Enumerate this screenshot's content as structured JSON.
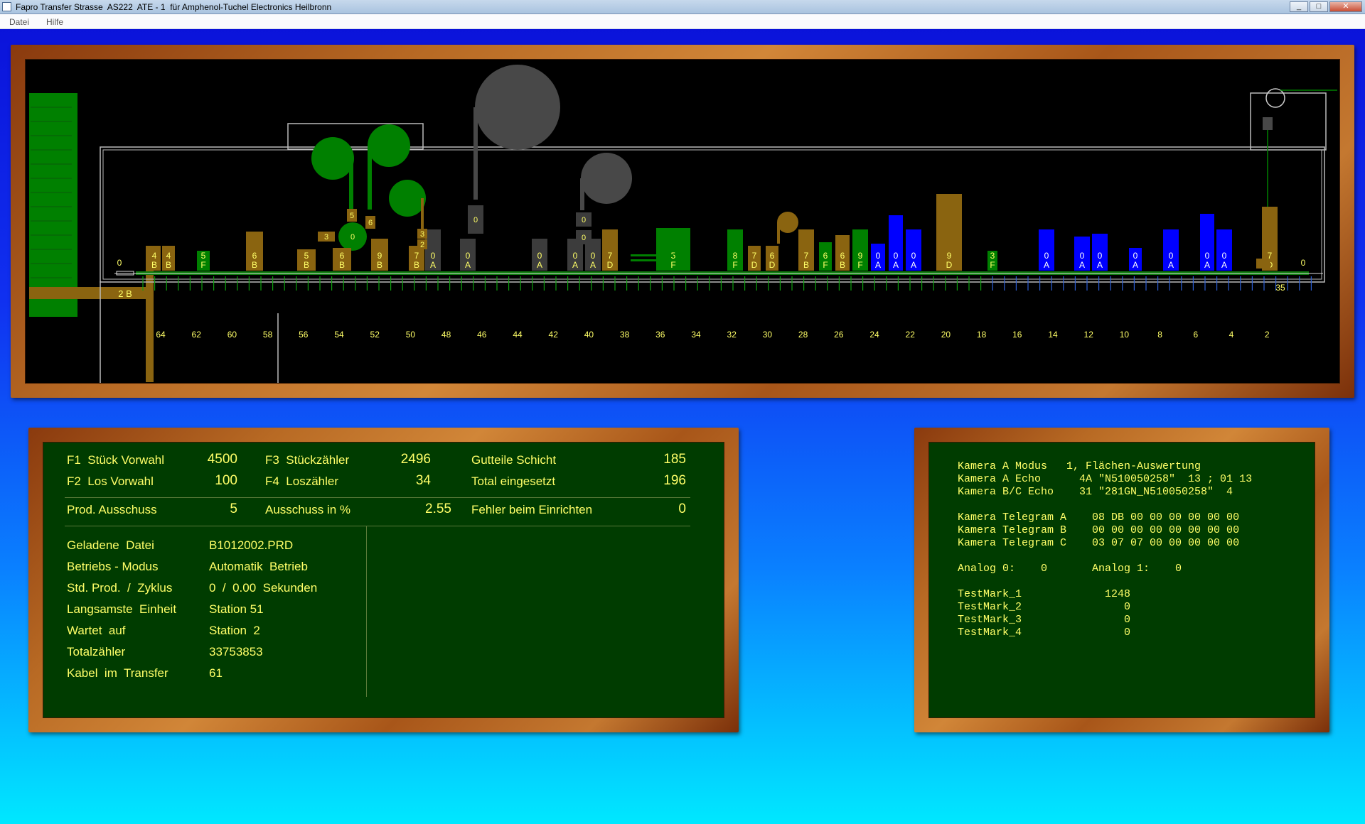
{
  "window": {
    "title": "Fapro Transfer Strasse  AS222  ATE - 1  für Amphenol-Tuchel Electronics Heilbronn",
    "minimize_symbol": "_",
    "maximize_symbol": "□",
    "close_symbol": "✕"
  },
  "menu": [
    "Datei",
    "Hilfe"
  ],
  "colors": {
    "part_green": "#008000",
    "part_brown": "#8a6410",
    "part_grey": "#3c3c3c",
    "part_blue": "#0000ff",
    "label_yellow": "#ffff68",
    "frame_wood": "#b86a24",
    "panel_green": "#003c00"
  },
  "schematic": {
    "feed_label": "2  B",
    "left_zero": "0",
    "right_zero": "0",
    "station_marker": "35",
    "station_numbers": [
      "64",
      "62",
      "60",
      "58",
      "56",
      "54",
      "52",
      "50",
      "48",
      "46",
      "44",
      "42",
      "40",
      "38",
      "36",
      "34",
      "32",
      "30",
      "28",
      "26",
      "24",
      "22",
      "20",
      "18",
      "16",
      "14",
      "12",
      "10",
      "8",
      "6",
      "4",
      "2"
    ],
    "parts": [
      {
        "num": "4",
        "letter": "B",
        "color": "brown"
      },
      {
        "num": "4",
        "letter": "B",
        "color": "brown"
      },
      {
        "num": "5",
        "letter": "F",
        "color": "green"
      },
      {
        "num": "6",
        "letter": "B",
        "color": "brown"
      },
      {
        "num": "5",
        "letter": "B",
        "color": "brown"
      },
      {
        "num": "6",
        "letter": "B",
        "color": "brown"
      },
      {
        "num": "9",
        "letter": "B",
        "color": "brown"
      },
      {
        "num": "7",
        "letter": "B",
        "color": "brown"
      },
      {
        "num": "0",
        "letter": "A",
        "color": "grey"
      },
      {
        "num": "0",
        "letter": "A",
        "color": "grey"
      },
      {
        "num": "0",
        "letter": "A",
        "color": "grey"
      },
      {
        "num": "0",
        "letter": "A",
        "color": "grey"
      },
      {
        "num": "0",
        "letter": "A",
        "color": "grey"
      },
      {
        "num": "7",
        "letter": "D",
        "color": "brown"
      },
      {
        "num": "5",
        "letter": "F",
        "color": "green"
      },
      {
        "num": "8",
        "letter": "F",
        "color": "green"
      },
      {
        "num": "7",
        "letter": "D",
        "color": "brown"
      },
      {
        "num": "6",
        "letter": "D",
        "color": "brown"
      },
      {
        "num": "7",
        "letter": "B",
        "color": "brown"
      },
      {
        "num": "6",
        "letter": "F",
        "color": "green"
      },
      {
        "num": "6",
        "letter": "B",
        "color": "brown"
      },
      {
        "num": "9",
        "letter": "F",
        "color": "green"
      },
      {
        "num": "0",
        "letter": "A",
        "color": "blue"
      },
      {
        "num": "0",
        "letter": "A",
        "color": "blue"
      },
      {
        "num": "0",
        "letter": "A",
        "color": "blue"
      },
      {
        "num": "9",
        "letter": "D",
        "color": "brown"
      },
      {
        "num": "3",
        "letter": "F",
        "color": "green"
      },
      {
        "num": "0",
        "letter": "A",
        "color": "blue"
      },
      {
        "num": "0",
        "letter": "A",
        "color": "blue"
      },
      {
        "num": "0",
        "letter": "A",
        "color": "blue"
      },
      {
        "num": "0",
        "letter": "A",
        "color": "blue"
      },
      {
        "num": "0",
        "letter": "A",
        "color": "blue"
      },
      {
        "num": "0",
        "letter": "A",
        "color": "blue"
      },
      {
        "num": "0",
        "letter": "A",
        "color": "blue"
      },
      {
        "num": "7",
        "letter": "D",
        "color": "brown"
      }
    ],
    "lifted_labels": [
      "5",
      "6",
      "3",
      "0",
      "3",
      "2",
      "0",
      "0",
      "0"
    ]
  },
  "production": {
    "f1_label": "F1  Stück Vorwahl",
    "f1_value": "4500",
    "f2_label": "F2  Los Vorwahl",
    "f2_value": "100",
    "f3_label": "F3  Stückzähler",
    "f3_value": "2496",
    "f4_label": "F4  Loszähler",
    "f4_value": "34",
    "gut_label": "Gutteile Schicht",
    "gut_value": "185",
    "total_label": "Total eingesetzt",
    "total_value": "196",
    "aus_label": "Prod. Ausschuss",
    "aus_value": "5",
    "ausp_label": "Ausschuss in %",
    "ausp_value": "2.55",
    "fehler_label": "Fehler beim Einrichten",
    "fehler_value": "0",
    "info": [
      {
        "label": "Geladene  Datei",
        "value": "B1012002.PRD"
      },
      {
        "label": "Betriebs - Modus",
        "value": "Automatik  Betrieb"
      },
      {
        "label": "Std. Prod.  /  Zyklus",
        "value": "0  /  0.00  Sekunden"
      },
      {
        "label": "Langsamste  Einheit",
        "value": "Station 51"
      },
      {
        "label": "Wartet  auf",
        "value": "Station  2"
      },
      {
        "label": "Totalzähler",
        "value": "33753853"
      },
      {
        "label": "Kabel  im  Transfer",
        "value": "61"
      }
    ]
  },
  "camera": {
    "lines": [
      "Kamera A Modus   1, Flächen-Auswertung",
      "Kamera A Echo      4A \"N510050258\"  13 ; 01 13",
      "Kamera B/C Echo    31 \"281GN_N510050258\"  4",
      "",
      "Kamera Telegram A    08 DB 00 00 00 00 00 00",
      "Kamera Telegram B    00 00 00 00 00 00 00 00",
      "Kamera Telegram C    03 07 07 00 00 00 00 00",
      "",
      "Analog 0:    0       Analog 1:    0",
      "",
      "TestMark_1             1248",
      "TestMark_2                0",
      "TestMark_3                0",
      "TestMark_4                0"
    ]
  }
}
